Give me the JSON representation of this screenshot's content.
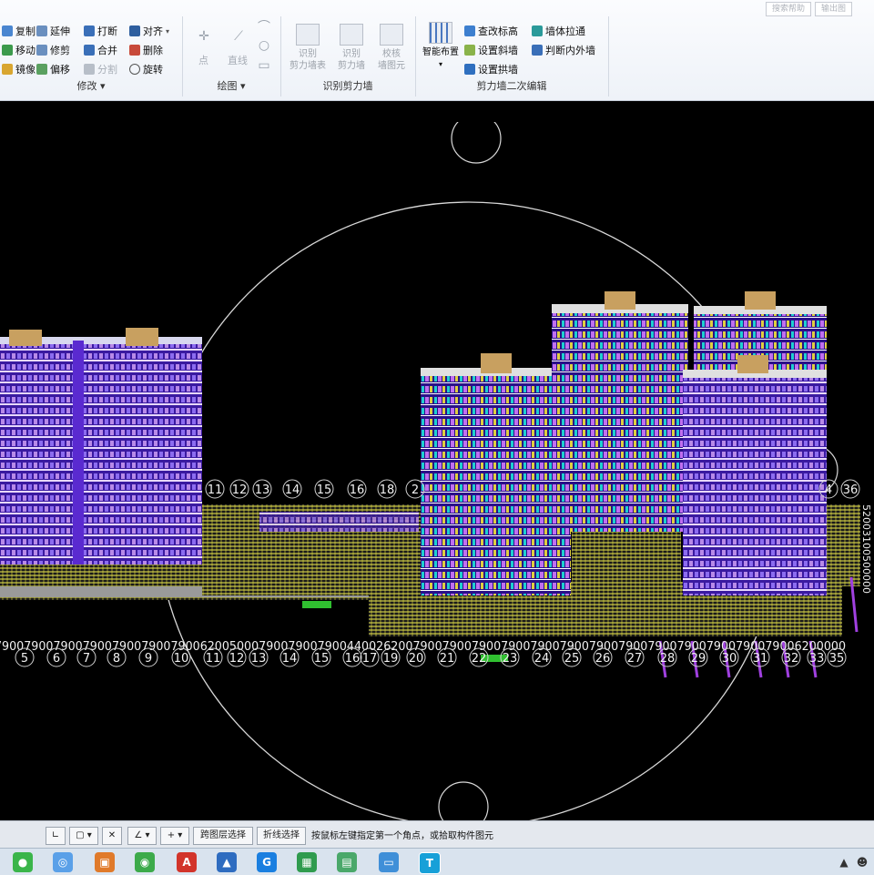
{
  "ribbon": {
    "search": [
      "搜索帮助",
      "输出图"
    ],
    "modify": {
      "title": "修改",
      "buttons": [
        "复制",
        "延伸",
        "打断",
        "对齐",
        "移动",
        "修剪",
        "合并",
        "删除",
        "镜像",
        "偏移",
        "分割",
        "旋转"
      ]
    },
    "draw": {
      "title": "绘图",
      "buttons": [
        "点",
        "直线"
      ]
    },
    "identify": {
      "title": "识别剪力墙",
      "buttons": [
        {
          "line1": "识别",
          "line2": "剪力墙表"
        },
        {
          "line1": "识别",
          "line2": "剪力墙"
        },
        {
          "line1": "校核",
          "line2": "墙图元"
        }
      ]
    },
    "secondary_edit": {
      "title": "剪力墙二次编辑",
      "smart": "智能布置",
      "buttons": [
        "查改标高",
        "墙体拉通",
        "设置斜墙",
        "判断内外墙",
        "设置拱墙"
      ]
    }
  },
  "canvas": {
    "axis_top": [
      "11",
      "12",
      "13",
      "14",
      "15",
      "16",
      "18",
      "2",
      "4",
      "36"
    ],
    "axis_bottom": [
      "5",
      "6",
      "7",
      "8",
      "9",
      "10",
      "11",
      "12",
      "13",
      "14",
      "15",
      "16",
      "17",
      "19",
      "20",
      "21",
      "22",
      "23",
      "24",
      "25",
      "26",
      "27",
      "28",
      "29",
      "30",
      "31",
      "32",
      "33",
      "35"
    ],
    "dim_strip": "79007900790079007900790079006200500079007900790044002620079007900790079007900790079007900790079007900790079006200000",
    "right_strip": "52003100500000"
  },
  "status": {
    "buttons": [
      "跨图层选择",
      "折线选择"
    ],
    "prompt": "按鼠标左键指定第一个角点，或拾取构件图元"
  },
  "taskbar": {
    "apps": [
      "wechat-icon",
      "qq-icon",
      "browser-icon",
      "chrome-icon",
      "pdf-icon",
      "image-viewer-icon",
      "glodon-icon",
      "sheets-icon",
      "calc-icon",
      "files-icon",
      "gtj-icon"
    ]
  }
}
